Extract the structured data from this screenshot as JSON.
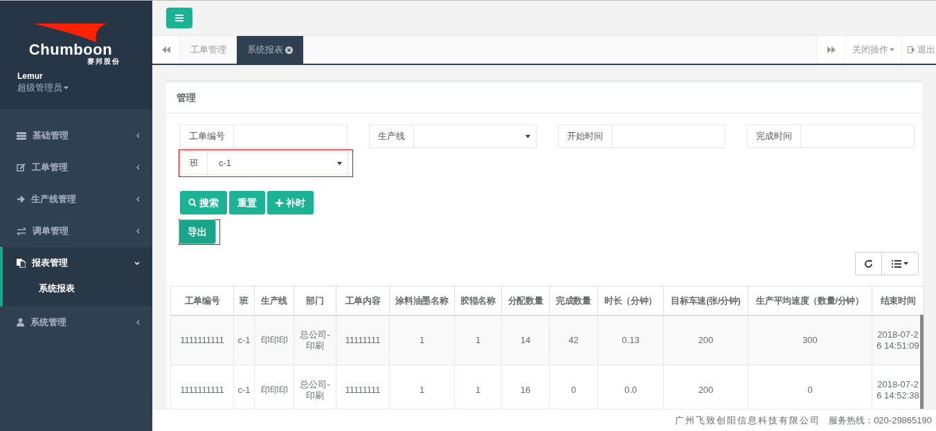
{
  "sidebar": {
    "logo": {
      "name": "Chumboon",
      "subtitle": "赛邦股份"
    },
    "user": {
      "name": "Lemur",
      "role": "超级管理员"
    },
    "items": [
      {
        "label": "基础管理",
        "expanded": false,
        "selected": false
      },
      {
        "label": "工单管理",
        "expanded": false,
        "selected": false
      },
      {
        "label": "生产线管理",
        "expanded": false,
        "selected": false
      },
      {
        "label": "调单管理",
        "expanded": false,
        "selected": false
      },
      {
        "label": "报表管理",
        "expanded": true,
        "selected": true,
        "children": [
          {
            "label": "系统报表",
            "selected": true
          }
        ]
      },
      {
        "label": "系统管理",
        "expanded": false,
        "selected": false
      }
    ]
  },
  "tabs": [
    {
      "label": "工单管理",
      "selected": false,
      "closable": false
    },
    {
      "label": "系统报表",
      "selected": true,
      "closable": true
    }
  ],
  "tab_actions": {
    "close_menu": "关闭操作",
    "logout": "退出"
  },
  "panel": {
    "title": "管理",
    "filters": [
      {
        "kind": "input",
        "label": "工单编号",
        "highlighted": false
      },
      {
        "kind": "select",
        "label": "生产线",
        "highlighted": false
      },
      {
        "kind": "input",
        "label": "开始时间",
        "highlighted": false
      },
      {
        "kind": "input",
        "label": "完成时间",
        "highlighted": false
      },
      {
        "kind": "select",
        "label": "班",
        "value": "c-1",
        "highlighted": true
      }
    ],
    "buttons": [
      {
        "label": "搜索",
        "highlighted": false
      },
      {
        "label": "重置",
        "highlighted": false
      },
      {
        "label": "补时",
        "highlighted": false
      },
      {
        "label": "导出",
        "highlighted": true
      }
    ],
    "table": {
      "columns": [
        "工单编号",
        "班",
        "生产线",
        "部门",
        "工单内容",
        "涂料油墨名称",
        "胶辊名称",
        "分配数量",
        "完成数量",
        "时长（分钟）",
        "目标车速(张/分钟)",
        "生产平均速度（数量/分钟）",
        "结束时间"
      ],
      "rows": [
        [
          "1111111111",
          "c-1",
          "印印印",
          "总公司-印刷",
          "11111111",
          "1",
          "1",
          "14",
          "42",
          "0.13",
          "200",
          "300",
          "2018-07-26 14:51:09"
        ],
        [
          "1111111111",
          "c-1",
          "印印印",
          "总公司-印刷",
          "11111111",
          "1",
          "1",
          "16",
          "0",
          "0.0",
          "200",
          "0",
          "2018-07-26 14:52:38"
        ]
      ]
    }
  },
  "footer": {
    "company": "广州飞致创阳信息科技有限公司",
    "hotline": "服务热线：020-29865190"
  }
}
